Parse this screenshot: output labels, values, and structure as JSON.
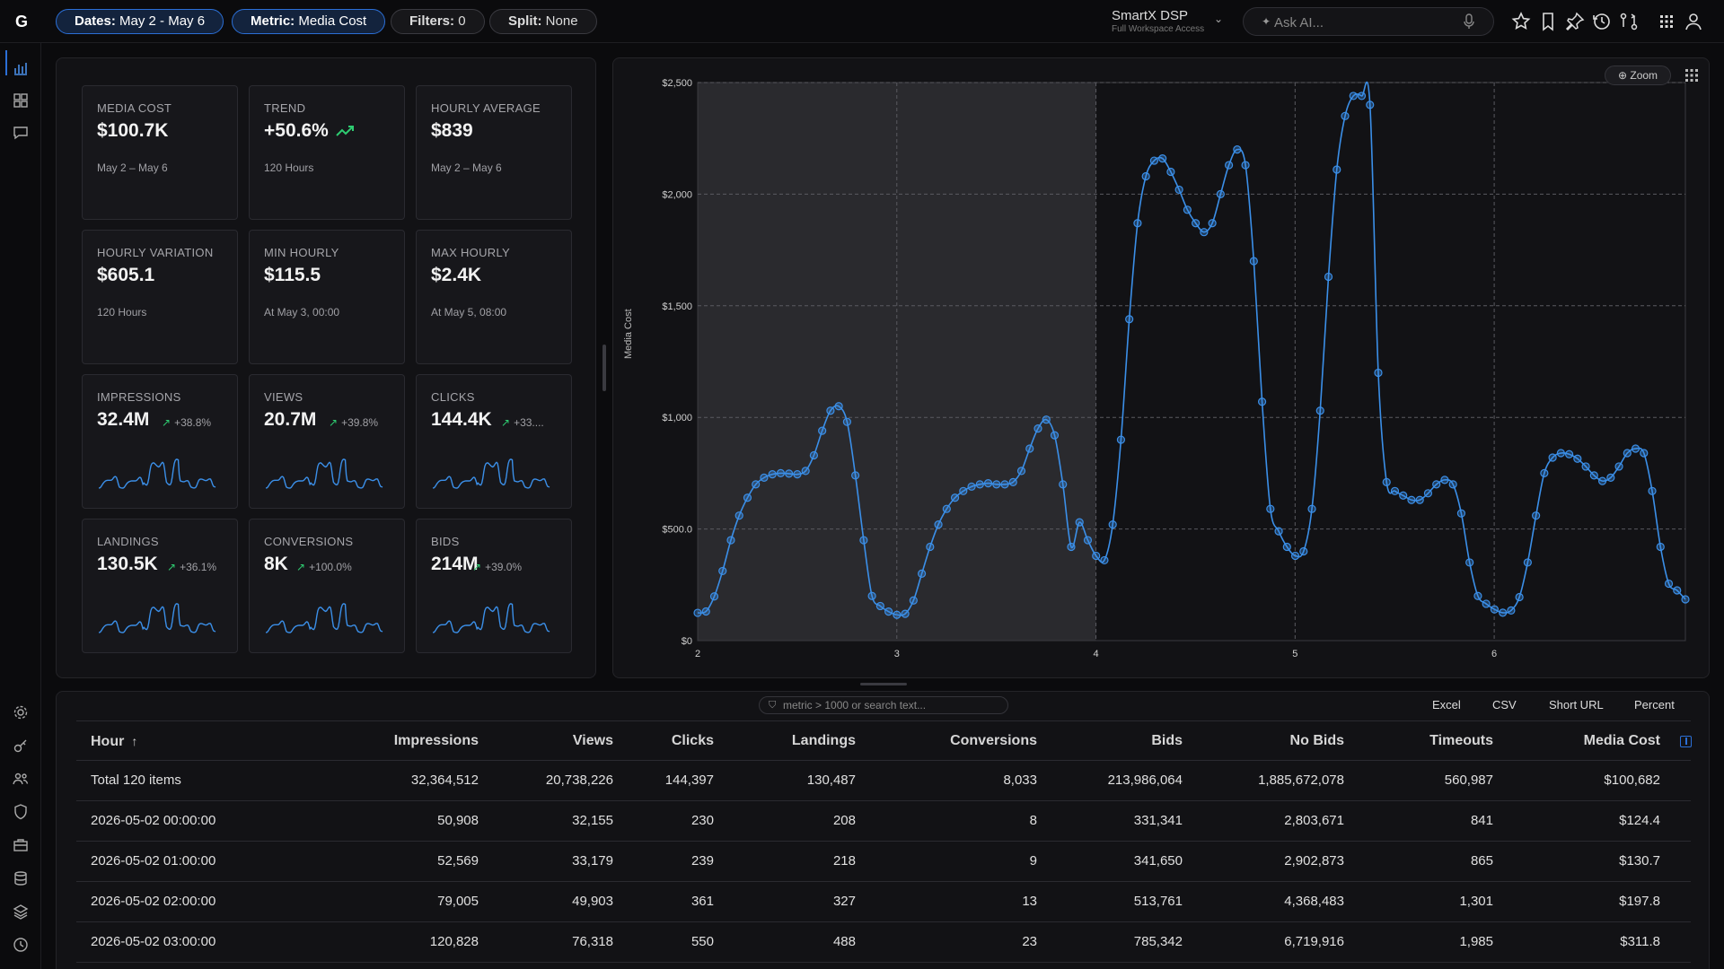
{
  "app": {
    "logo": "G"
  },
  "topbar": {
    "dates": {
      "label": "Dates:",
      "value": "May 2 - May 6"
    },
    "metric": {
      "label": "Metric:",
      "value": "Media Cost"
    },
    "filters": {
      "label": "Filters:",
      "value": "0"
    },
    "split": {
      "label": "Split:",
      "value": "None"
    },
    "workspace": {
      "name": "SmartX DSP",
      "access": "Full Workspace Access"
    },
    "ask_placeholder": "Ask AI..."
  },
  "kpis": [
    {
      "label": "MEDIA COST",
      "value": "$100.7K",
      "sub": "May 2 – May 6"
    },
    {
      "label": "TREND",
      "value": "+50.6%",
      "sub": "120 Hours",
      "trend": "up"
    },
    {
      "label": "HOURLY AVERAGE",
      "value": "$839",
      "sub": "May 2 – May 6"
    },
    {
      "label": "HOURLY VARIATION",
      "value": "$605.1",
      "sub": "120 Hours"
    },
    {
      "label": "MIN HOURLY",
      "value": "$115.5",
      "sub": "At May 3, 00:00"
    },
    {
      "label": "MAX HOURLY",
      "value": "$2.4K",
      "sub": "At May 5, 08:00"
    },
    {
      "label": "IMPRESSIONS",
      "value": "32.4M",
      "delta": "+38.8%"
    },
    {
      "label": "VIEWS",
      "value": "20.7M",
      "delta": "+39.8%"
    },
    {
      "label": "CLICKS",
      "value": "144.4K",
      "delta": "+33...."
    },
    {
      "label": "LANDINGS",
      "value": "130.5K",
      "delta": "+36.1%"
    },
    {
      "label": "CONVERSIONS",
      "value": "8K",
      "delta": "+100.0%"
    },
    {
      "label": "BIDS",
      "value": "214M",
      "delta": "+39.0%"
    }
  ],
  "chart": {
    "zoom_label": "Zoom",
    "ylabel": "Media Cost"
  },
  "chart_data": {
    "type": "line",
    "ylabel": "Media Cost",
    "xlim": [
      2,
      6.96
    ],
    "ylim": [
      0,
      2500
    ],
    "x_ticks": [
      "2",
      "3",
      "4",
      "5",
      "6"
    ],
    "y_ticks": [
      "$0",
      "$500.0",
      "$1,000",
      "$1,500",
      "$2,000",
      "$2,500"
    ],
    "highlight_range": [
      2,
      4
    ],
    "grid": true,
    "series": [
      {
        "values": [
          124.4,
          130.7,
          197.8,
          311.8,
          450,
          560,
          640,
          700,
          730,
          745,
          750,
          748,
          745,
          760,
          830,
          940,
          1030,
          1050,
          980,
          740,
          450,
          200,
          155,
          130,
          115.5,
          120,
          180,
          300,
          420,
          520,
          590,
          640,
          670,
          690,
          700,
          705,
          700,
          700,
          710,
          760,
          860,
          950,
          990,
          920,
          700,
          420,
          530,
          450,
          380,
          360,
          520,
          900,
          1440,
          1870,
          2080,
          2150,
          2160,
          2100,
          2020,
          1930,
          1870,
          1830,
          1870,
          2000,
          2130,
          2200,
          2130,
          1700,
          1070,
          590,
          490,
          420,
          380,
          400,
          590,
          1030,
          1630,
          2110,
          2350,
          2440,
          2440,
          2400,
          1200,
          710,
          670,
          650,
          630,
          630,
          660,
          700,
          720,
          700,
          570,
          350,
          200,
          165,
          140,
          125,
          135,
          195,
          350,
          560,
          750,
          820,
          840,
          835,
          815,
          780,
          740,
          715,
          730,
          780,
          840,
          860,
          840,
          670,
          420,
          255,
          225,
          185
        ]
      }
    ]
  },
  "table": {
    "filter_placeholder": "metric > 1000 or search text...",
    "exports": [
      "Excel",
      "CSV",
      "Short URL",
      "Percent"
    ],
    "sort_indicator": "↑",
    "columns": [
      "Hour",
      "Impressions",
      "Views",
      "Clicks",
      "Landings",
      "Conversions",
      "Bids",
      "No Bids",
      "Timeouts",
      "Media Cost"
    ],
    "rows": [
      [
        "Total 120 items",
        "32,364,512",
        "20,738,226",
        "144,397",
        "130,487",
        "8,033",
        "213,986,064",
        "1,885,672,078",
        "560,987",
        "$100,682"
      ],
      [
        "2026-05-02 00:00:00",
        "50,908",
        "32,155",
        "230",
        "208",
        "8",
        "331,341",
        "2,803,671",
        "841",
        "$124.4"
      ],
      [
        "2026-05-02 01:00:00",
        "52,569",
        "33,179",
        "239",
        "218",
        "9",
        "341,650",
        "2,902,873",
        "865",
        "$130.7"
      ],
      [
        "2026-05-02 02:00:00",
        "79,005",
        "49,903",
        "361",
        "327",
        "13",
        "513,761",
        "4,368,483",
        "1,301",
        "$197.8"
      ],
      [
        "2026-05-02 03:00:00",
        "120,828",
        "76,318",
        "550",
        "488",
        "23",
        "785,342",
        "6,719,916",
        "1,985",
        "$311.8"
      ]
    ]
  },
  "colors": {
    "accent": "#2b6fd6",
    "line": "#3b8fe8",
    "trend_up": "#2ecc71"
  },
  "icons": {
    "top": [
      "star-icon",
      "bookmark-icon",
      "pin-icon",
      "history-icon",
      "compare-icon",
      "apps-icon",
      "user-icon"
    ],
    "rail": [
      "chart-icon",
      "dashboard-icon",
      "chat-icon",
      "settings-icon",
      "key-icon",
      "users-icon",
      "shield-icon",
      "briefcase-icon",
      "database-icon",
      "layers-icon",
      "clock-icon"
    ]
  }
}
